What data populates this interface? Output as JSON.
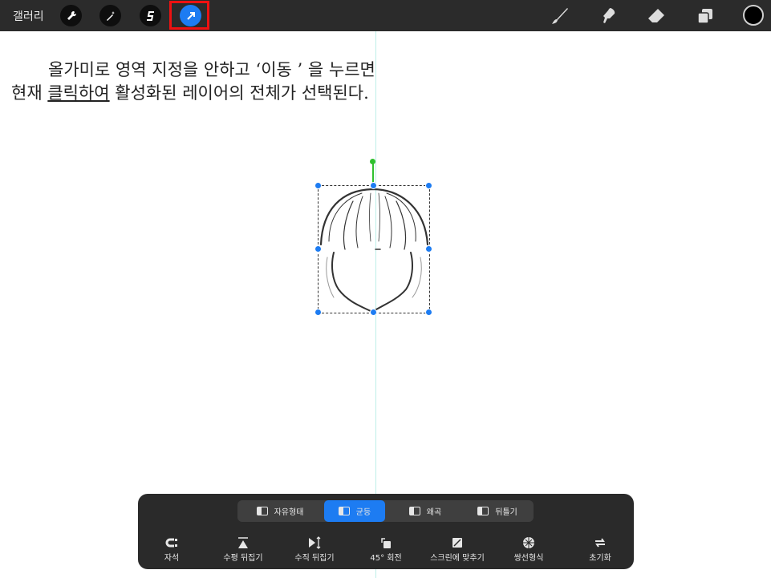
{
  "topbar": {
    "gallery": "갤러리",
    "tools": [
      "wrench-icon",
      "magic-wand-icon",
      "selection-s-icon",
      "move-arrow-icon"
    ],
    "right_tools": [
      "brush-icon",
      "smudge-icon",
      "eraser-icon",
      "layers-icon"
    ],
    "color": "#000000"
  },
  "caption": {
    "line1": "올가미로 영역 지정을 안하고 ‘이동 ’ 을 누르면",
    "line2_pre": "현재 ",
    "line2_u": "클릭하여",
    "line2_post": " 활성화된 레이어의 전체가 선택된다."
  },
  "panel": {
    "segments": [
      "자유형태",
      "균등",
      "왜곡",
      "뒤틀기"
    ],
    "active_segment": "균등",
    "actions": [
      "자석",
      "수평 뒤집기",
      "수직 뒤집기",
      "45° 회전",
      "스크린에 맞추기",
      "쌍선형식",
      "초기화"
    ]
  },
  "colors": {
    "accent": "#1d7cf2",
    "highlight": "#e11111",
    "bar": "#2b2b2b"
  }
}
